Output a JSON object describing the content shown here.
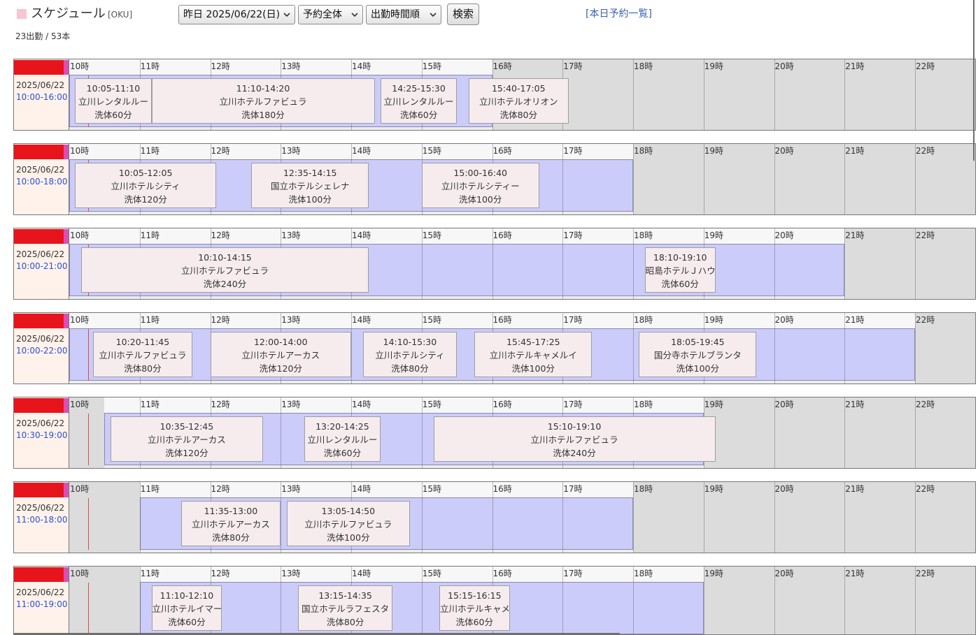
{
  "header": {
    "title": "スケジュール",
    "subtitle": "[OKU]",
    "date_select": "昨日 2025/06/22(日)",
    "scope_select": "予約全体",
    "sort_select": "出勤時間順",
    "search_label": "検索",
    "today_link": "[本日予約一覧]",
    "summary": "23出勤 / 53本"
  },
  "icons": {
    "brand": "pink-square-icon",
    "select": "chevron-down-icon"
  },
  "colors": {
    "work_band": "#ccccfa",
    "off_hours": "#dcdcdc",
    "work_header": "#f7f7f7",
    "reservation_bg": "#f6ecee",
    "work_time_text": "#2b50d8",
    "current_time_line": "#e04848",
    "redaction": "#e8141c",
    "name_bg": "#d94fb6",
    "info_bg": "#fff2ea",
    "link": "#3b62b0",
    "brand": "#f8c6d0"
  },
  "timeline": {
    "hours": [
      "10時",
      "11時",
      "12時",
      "13時",
      "14時",
      "15時",
      "16時",
      "17時",
      "18時",
      "19時",
      "20時",
      "21時",
      "22時"
    ],
    "now_marker": "10:16"
  },
  "staff": [
    {
      "date": "2025/06/22",
      "work_time": "10:00-16:00",
      "reservations": [
        {
          "time": "10:05-11:10",
          "place": "立川レンタルルー",
          "course": "洗体60分"
        },
        {
          "time": "11:10-14:20",
          "place": "立川ホテルファビュラ",
          "course": "洗体180分"
        },
        {
          "time": "14:25-15:30",
          "place": "立川レンタルルー",
          "course": "洗体60分"
        },
        {
          "time": "15:40-17:05",
          "place": "立川ホテルオリオン",
          "course": "洗体80分"
        }
      ]
    },
    {
      "date": "2025/06/22",
      "work_time": "10:00-18:00",
      "reservations": [
        {
          "time": "10:05-12:05",
          "place": "立川ホテルシティ",
          "course": "洗体120分"
        },
        {
          "time": "12:35-14:15",
          "place": "国立ホテルシェレナ",
          "course": "洗体100分"
        },
        {
          "time": "15:00-16:40",
          "place": "立川ホテルシティー",
          "course": "洗体100分"
        }
      ]
    },
    {
      "date": "2025/06/22",
      "work_time": "10:00-21:00",
      "reservations": [
        {
          "time": "10:10-14:15",
          "place": "立川ホテルファビュラ",
          "course": "洗体240分"
        },
        {
          "time": "18:10-19:10",
          "place": "昭島ホテルＪハウ",
          "course": "洗体60分"
        }
      ]
    },
    {
      "date": "2025/06/22",
      "work_time": "10:00-22:00",
      "reservations": [
        {
          "time": "10:20-11:45",
          "place": "立川ホテルファビュラ",
          "course": "洗体80分"
        },
        {
          "time": "12:00-14:00",
          "place": "立川ホテルアーカス",
          "course": "洗体120分"
        },
        {
          "time": "14:10-15:30",
          "place": "立川ホテルシティ",
          "course": "洗体80分"
        },
        {
          "time": "15:45-17:25",
          "place": "立川ホテルキャメルイ",
          "course": "洗体100分"
        },
        {
          "time": "18:05-19:45",
          "place": "国分寺ホテルブランタ",
          "course": "洗体100分"
        }
      ]
    },
    {
      "date": "2025/06/22",
      "work_time": "10:30-19:00",
      "reservations": [
        {
          "time": "10:35-12:45",
          "place": "立川ホテルアーカス",
          "course": "洗体120分"
        },
        {
          "time": "13:20-14:25",
          "place": "立川レンタルルー",
          "course": "洗体60分"
        },
        {
          "time": "15:10-19:10",
          "place": "立川ホテルファビュラ",
          "course": "洗体240分"
        }
      ]
    },
    {
      "date": "2025/06/22",
      "work_time": "11:00-18:00",
      "reservations": [
        {
          "time": "11:35-13:00",
          "place": "立川ホテルアーカス",
          "course": "洗体80分"
        },
        {
          "time": "13:05-14:50",
          "place": "立川ホテルファビュラ",
          "course": "洗体100分"
        }
      ]
    },
    {
      "date": "2025/06/22",
      "work_time": "11:00-19:00",
      "reservations": [
        {
          "time": "11:10-12:10",
          "place": "立川ホテルイマー",
          "course": "洗体60分"
        },
        {
          "time": "13:15-14:35",
          "place": "国立ホテルラフェスタ",
          "course": "洗体80分"
        },
        {
          "time": "15:15-16:15",
          "place": "立川ホテルキャメ",
          "course": "洗体60分"
        }
      ]
    }
  ]
}
